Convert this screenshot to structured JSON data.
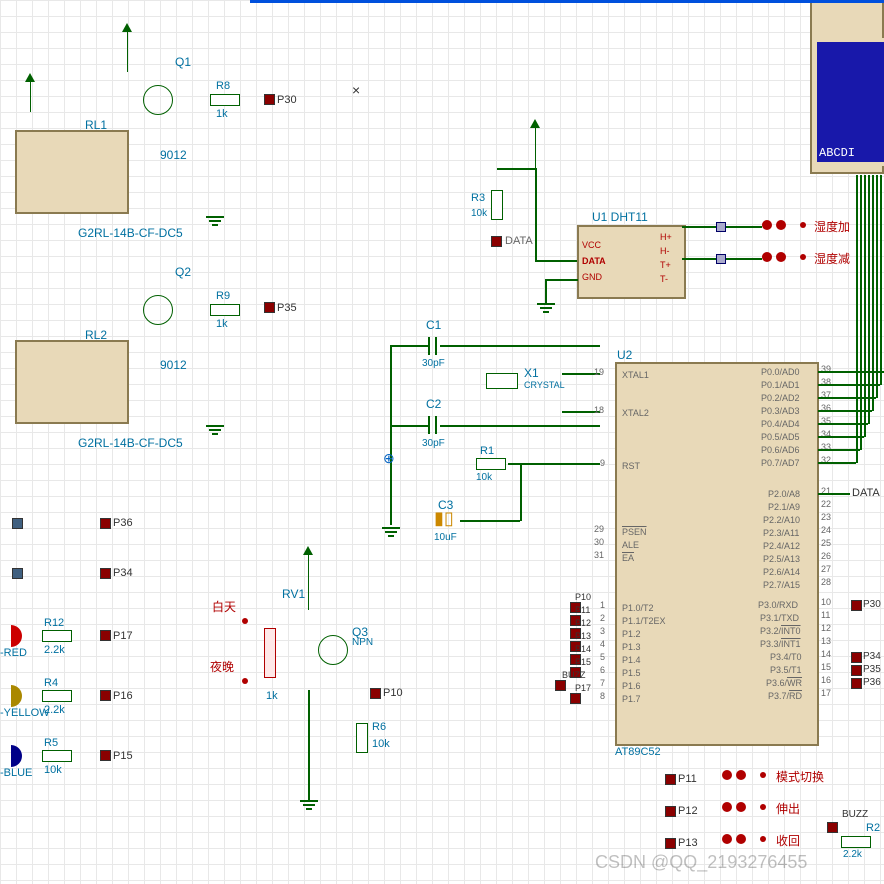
{
  "chart_data": {
    "type": "schematic",
    "components": [
      {
        "ref": "Q1",
        "type": "PNP",
        "value": "9012"
      },
      {
        "ref": "Q2",
        "type": "PNP",
        "value": "9012"
      },
      {
        "ref": "Q3",
        "type": "NPN",
        "value": "NPN"
      },
      {
        "ref": "RL1",
        "type": "Relay",
        "value": "G2RL-14B-CF-DC5"
      },
      {
        "ref": "RL2",
        "type": "Relay",
        "value": "G2RL-14B-CF-DC5"
      },
      {
        "ref": "R1",
        "value": "10k"
      },
      {
        "ref": "R2",
        "value": "2.2k"
      },
      {
        "ref": "R3",
        "value": "10k"
      },
      {
        "ref": "R4",
        "value": "2.2k"
      },
      {
        "ref": "R5",
        "value": "10k"
      },
      {
        "ref": "R6",
        "value": "10k"
      },
      {
        "ref": "R8",
        "value": "1k"
      },
      {
        "ref": "R9",
        "value": "1k"
      },
      {
        "ref": "R12",
        "value": "2.2k"
      },
      {
        "ref": "RV1",
        "type": "Potentiometer",
        "value": "1k"
      },
      {
        "ref": "C1",
        "value": "30pF"
      },
      {
        "ref": "C2",
        "value": "30pF"
      },
      {
        "ref": "C3",
        "value": "10uF"
      },
      {
        "ref": "X1",
        "type": "Crystal",
        "value": "CRYSTAL"
      },
      {
        "ref": "U1",
        "type": "DHT11",
        "pins": [
          "VCC",
          "DATA",
          "GND",
          "H+",
          "H-",
          "T+",
          "T-"
        ]
      },
      {
        "ref": "U2",
        "type": "AT89C52",
        "pins_left": [
          {
            "num": 19,
            "name": "XTAL1"
          },
          {
            "num": 18,
            "name": "XTAL2"
          },
          {
            "num": 9,
            "name": "RST"
          },
          {
            "num": 29,
            "name": "PSEN",
            "ovl": true
          },
          {
            "num": 30,
            "name": "ALE"
          },
          {
            "num": 31,
            "name": "EA",
            "ovl": true
          },
          {
            "num": 1,
            "name": "P1.0/T2"
          },
          {
            "num": 2,
            "name": "P1.1/T2EX"
          },
          {
            "num": 3,
            "name": "P1.2"
          },
          {
            "num": 4,
            "name": "P1.3"
          },
          {
            "num": 5,
            "name": "P1.4"
          },
          {
            "num": 6,
            "name": "P1.5"
          },
          {
            "num": 7,
            "name": "P1.6"
          },
          {
            "num": 8,
            "name": "P1.7"
          }
        ],
        "pins_right": [
          {
            "num": 39,
            "name": "P0.0/AD0"
          },
          {
            "num": 38,
            "name": "P0.1/AD1"
          },
          {
            "num": 37,
            "name": "P0.2/AD2"
          },
          {
            "num": 36,
            "name": "P0.3/AD3"
          },
          {
            "num": 35,
            "name": "P0.4/AD4"
          },
          {
            "num": 34,
            "name": "P0.5/AD5"
          },
          {
            "num": 33,
            "name": "P0.6/AD6"
          },
          {
            "num": 32,
            "name": "P0.7/AD7"
          },
          {
            "num": 21,
            "name": "P2.0/A8"
          },
          {
            "num": 22,
            "name": "P2.1/A9"
          },
          {
            "num": 23,
            "name": "P2.2/A10"
          },
          {
            "num": 24,
            "name": "P2.3/A11"
          },
          {
            "num": 25,
            "name": "P2.4/A12"
          },
          {
            "num": 26,
            "name": "P2.5/A13"
          },
          {
            "num": 27,
            "name": "P2.6/A14"
          },
          {
            "num": 28,
            "name": "P2.7/A15"
          },
          {
            "num": 10,
            "name": "P3.0/RXD"
          },
          {
            "num": 11,
            "name": "P3.1/TXD"
          },
          {
            "num": 12,
            "name": "P3.2/INT0",
            "ovl": true
          },
          {
            "num": 13,
            "name": "P3.3/INT1",
            "ovl": true
          },
          {
            "num": 14,
            "name": "P3.4/T0"
          },
          {
            "num": 15,
            "name": "P3.5/T1"
          },
          {
            "num": 16,
            "name": "P3.6/WR",
            "ovl": true
          },
          {
            "num": 17,
            "name": "P3.7/RD",
            "ovl": true
          }
        ]
      }
    ],
    "nets": [
      "P30",
      "P35",
      "P36",
      "P34",
      "P17",
      "P16",
      "P15",
      "P10",
      "P11",
      "P12",
      "P13",
      "P14",
      "BUZZ",
      "DATA"
    ],
    "buttons": [
      "湿度加",
      "湿度减",
      "模式切换",
      "伸出",
      "收回"
    ],
    "light_labels": [
      "白天",
      "夜晚"
    ],
    "led_colors": [
      "RED",
      "YELLOW",
      "BLUE"
    ],
    "lcd_text": "ABCDI",
    "watermark": "CSDN @QQ_2193276455"
  },
  "labels": {
    "Q1": "Q1",
    "Q2": "Q2",
    "Q3": "Q3",
    "R1": "R1",
    "R2": "R2",
    "R3": "R3",
    "R4": "R4",
    "R5": "R5",
    "R6": "R6",
    "R8": "R8",
    "R9": "R9",
    "R12": "R12",
    "RV1": "RV1",
    "RL1": "RL1",
    "RL2": "RL2",
    "C1": "C1",
    "C2": "C2",
    "C3": "C3",
    "X1": "X1",
    "U1": "U1 DHT11",
    "U2": "U2",
    "AT89C52": "AT89C52",
    "LED_RED": "-RED",
    "LED_YELLOW": "-YELLOW",
    "LED_BLUE": "-BLUE",
    "DATA": "DATA",
    "CRYSTAL": "CRYSTAL",
    "NPN": "NPN",
    "val_1k": "1k",
    "val_10k": "10k",
    "val_22k": "2.2k",
    "val_30pF": "30pF",
    "val_10uF": "10uF",
    "val_9012": "9012",
    "G2RL": "G2RL-14B-CF-DC5",
    "P30": "P30",
    "P35": "P35",
    "P36": "P36",
    "P34": "P34",
    "P17": "P17",
    "P16": "P16",
    "P15": "P15",
    "P10": "P10",
    "P11": "P11",
    "P12": "P12",
    "P13": "P13",
    "P14": "P14",
    "BUZZ": "BUZZ",
    "humid_plus": "湿度加",
    "humid_minus": "湿度减",
    "mode": "模式切换",
    "extend": "伸出",
    "retract": "收回",
    "day": "白天",
    "night": "夜晚",
    "LCDTEXT": "ABCDI",
    "VCC": "VCC",
    "GND": "GND",
    "Hp": "H+",
    "Hm": "H-",
    "Tp": "T+",
    "Tm": "T-",
    "XTAL1": "XTAL1",
    "XTAL2": "XTAL2",
    "RST": "RST",
    "PSEN": "PSEN",
    "ALE": "ALE",
    "EA": "EA"
  },
  "watermark": "CSDN @QQ_2193276455"
}
